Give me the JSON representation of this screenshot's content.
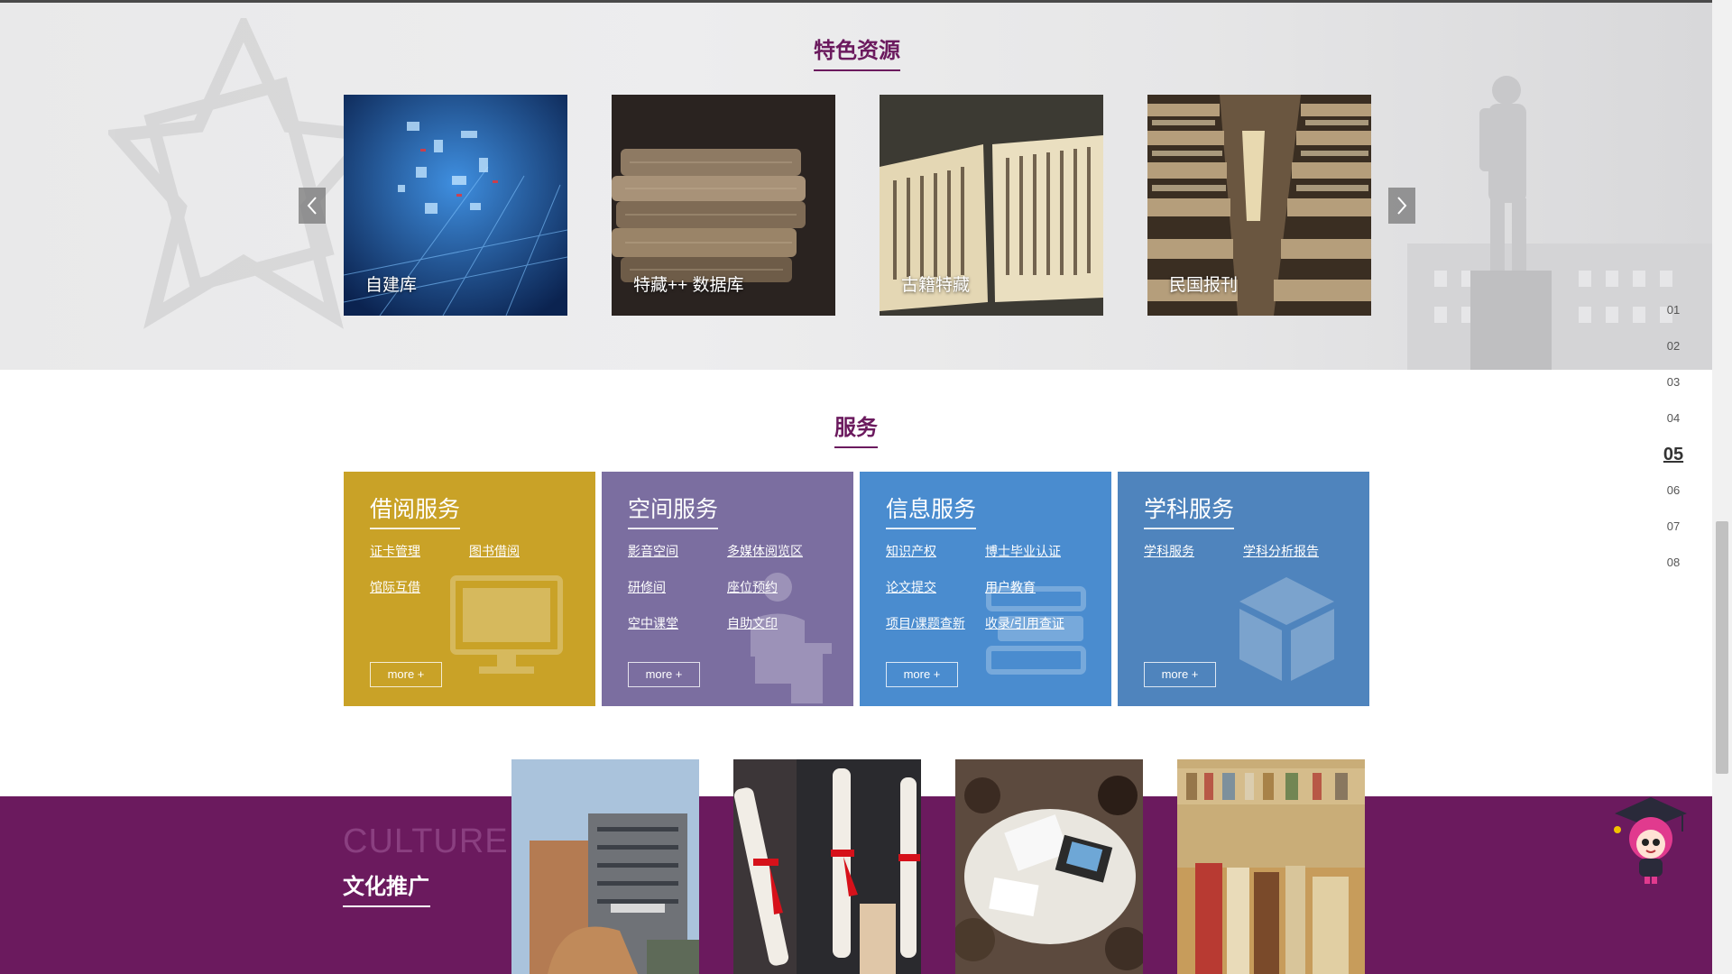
{
  "featured": {
    "title": "特色资源",
    "cards": [
      {
        "caption": "自建库"
      },
      {
        "caption": "特藏++ 数据库"
      },
      {
        "caption": "古籍特藏"
      },
      {
        "caption": "民国报刊"
      }
    ],
    "prev_icon": "chevron-left-icon",
    "next_icon": "chevron-right-icon"
  },
  "sidenav": {
    "items": [
      "01",
      "02",
      "03",
      "04",
      "05",
      "06",
      "07",
      "08"
    ],
    "active": "05"
  },
  "services": {
    "title": "服务",
    "cards": [
      {
        "title": "借阅服务",
        "color": "#c9a227",
        "icon": "monitor-icon",
        "links": [
          "证卡管理",
          "图书借阅",
          "馆际互借"
        ],
        "more": "more +"
      },
      {
        "title": "空间服务",
        "color": "#7b6ea0",
        "icon": "presenter-icon",
        "links": [
          "影音空间",
          "多媒体阅览区",
          "研修间",
          "座位预约",
          "空中课堂",
          "自助文印"
        ],
        "more": "more +"
      },
      {
        "title": "信息服务",
        "color": "#4a8ccf",
        "icon": "book-stack-icon",
        "links": [
          "知识产权",
          "博士毕业认证",
          "论文提交",
          "用户教育",
          "项目/课题查新",
          "收录/引用查证"
        ],
        "more": "more +"
      },
      {
        "title": "学科服务",
        "color": "#4f84bd",
        "icon": "cube-icon",
        "links": [
          "学科服务",
          "学科分析报告"
        ],
        "more": "more +"
      }
    ]
  },
  "culture": {
    "en": "CULTURE",
    "cn": "文化推广",
    "bg": "#6b1a5e"
  }
}
